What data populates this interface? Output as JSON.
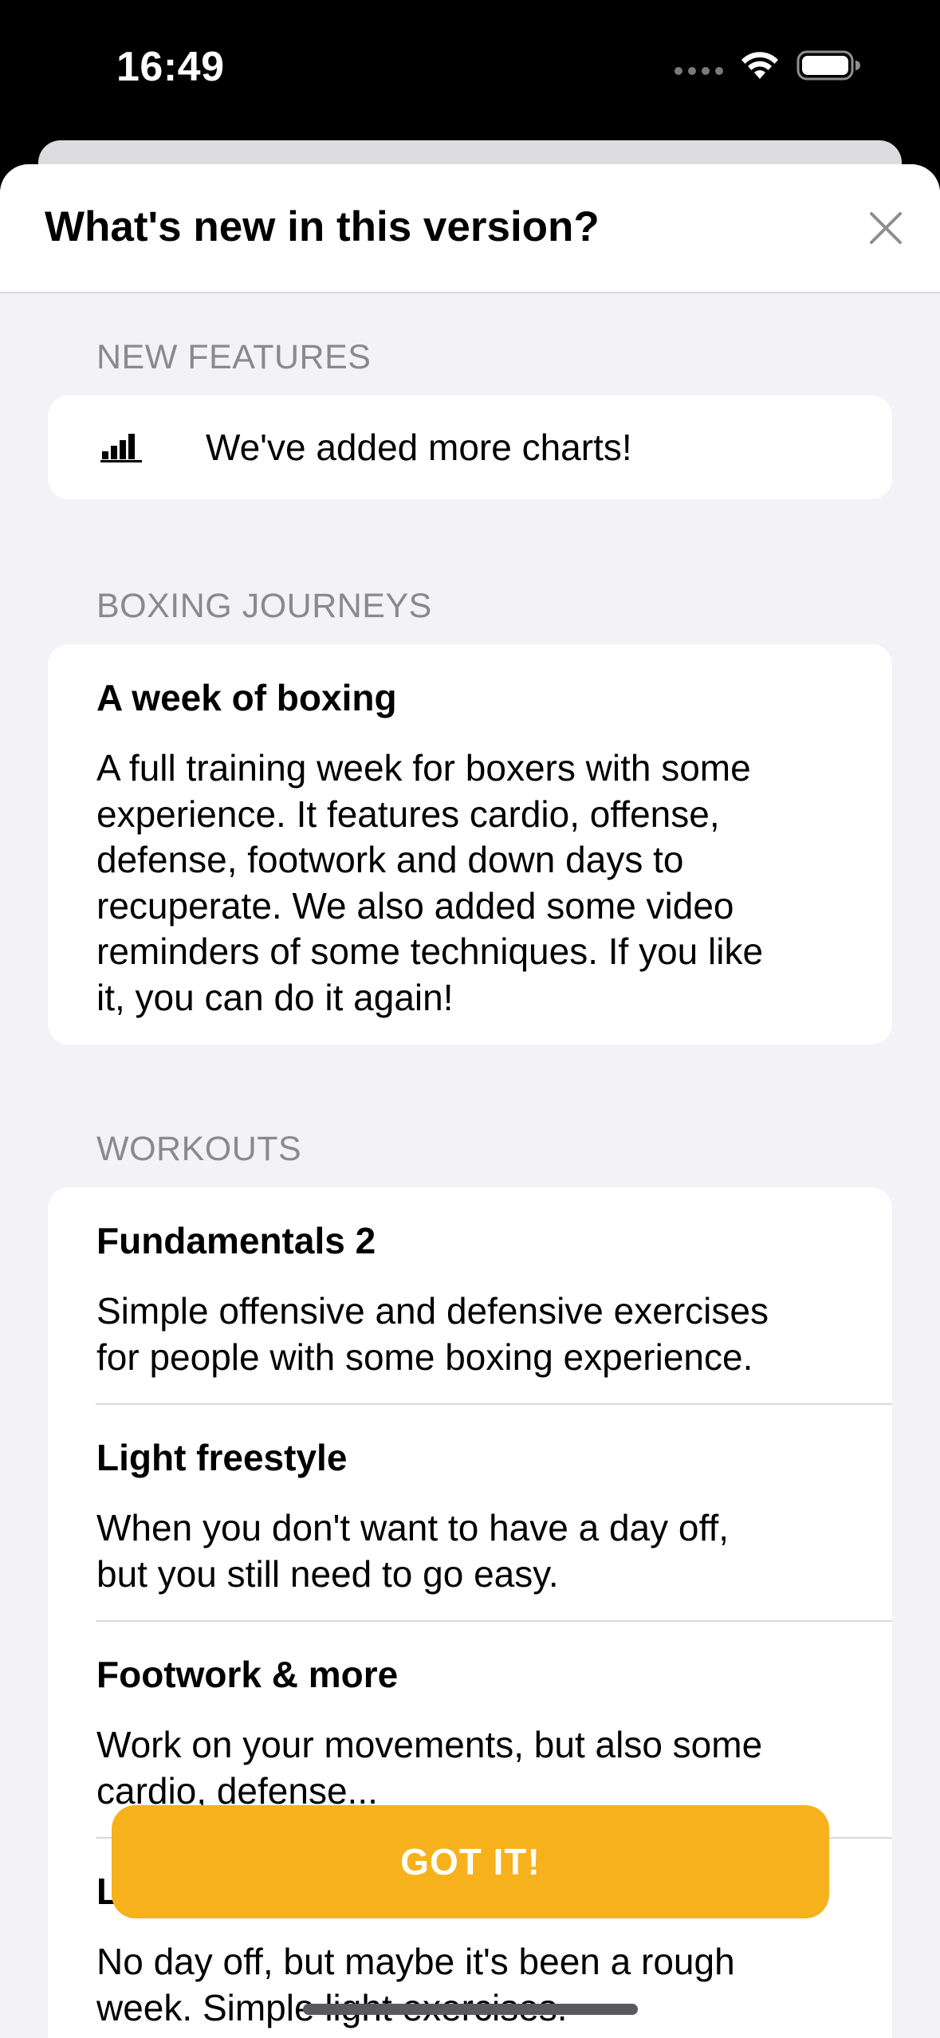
{
  "status_bar": {
    "time": "16:49",
    "icons": [
      "cellular-signal-icon",
      "wifi-icon",
      "battery-icon"
    ]
  },
  "sheet": {
    "title": "What's new in this version?",
    "close_icon": "close-icon"
  },
  "new_features": {
    "label": "NEW FEATURES",
    "items": [
      {
        "icon": "bar-chart-icon",
        "text": "We've added more charts!"
      }
    ]
  },
  "boxing_journeys": {
    "label": "BOXING JOURNEYS",
    "items": [
      {
        "title": "A week of boxing",
        "description_lines": [
          "A full training week for boxers with some",
          "experience. It features cardio, offense,",
          "defense, footwork and down days to",
          "recuperate. We also added some video",
          "reminders of some techniques. If you like",
          "it, you can do it again!"
        ]
      }
    ]
  },
  "workouts": {
    "label": "WORKOUTS",
    "items": [
      {
        "title": "Fundamentals 2",
        "description_lines": [
          "Simple offensive and defensive exercises",
          "for people with some boxing experience."
        ]
      },
      {
        "title": "Light freestyle",
        "description_lines": [
          "When you don't want to have a day off,",
          "but you still need to go easy."
        ]
      },
      {
        "title": "Footwork & more",
        "description_lines": [
          "Work on your movements, but also some",
          "cardio, defense..."
        ]
      },
      {
        "title": "L",
        "description_lines": [
          "No day off, but maybe it's been a rough",
          "week. Simple light exercises."
        ]
      }
    ]
  },
  "footer": {
    "button_label": "GOT IT!",
    "accent_color": "#F7B11C"
  }
}
